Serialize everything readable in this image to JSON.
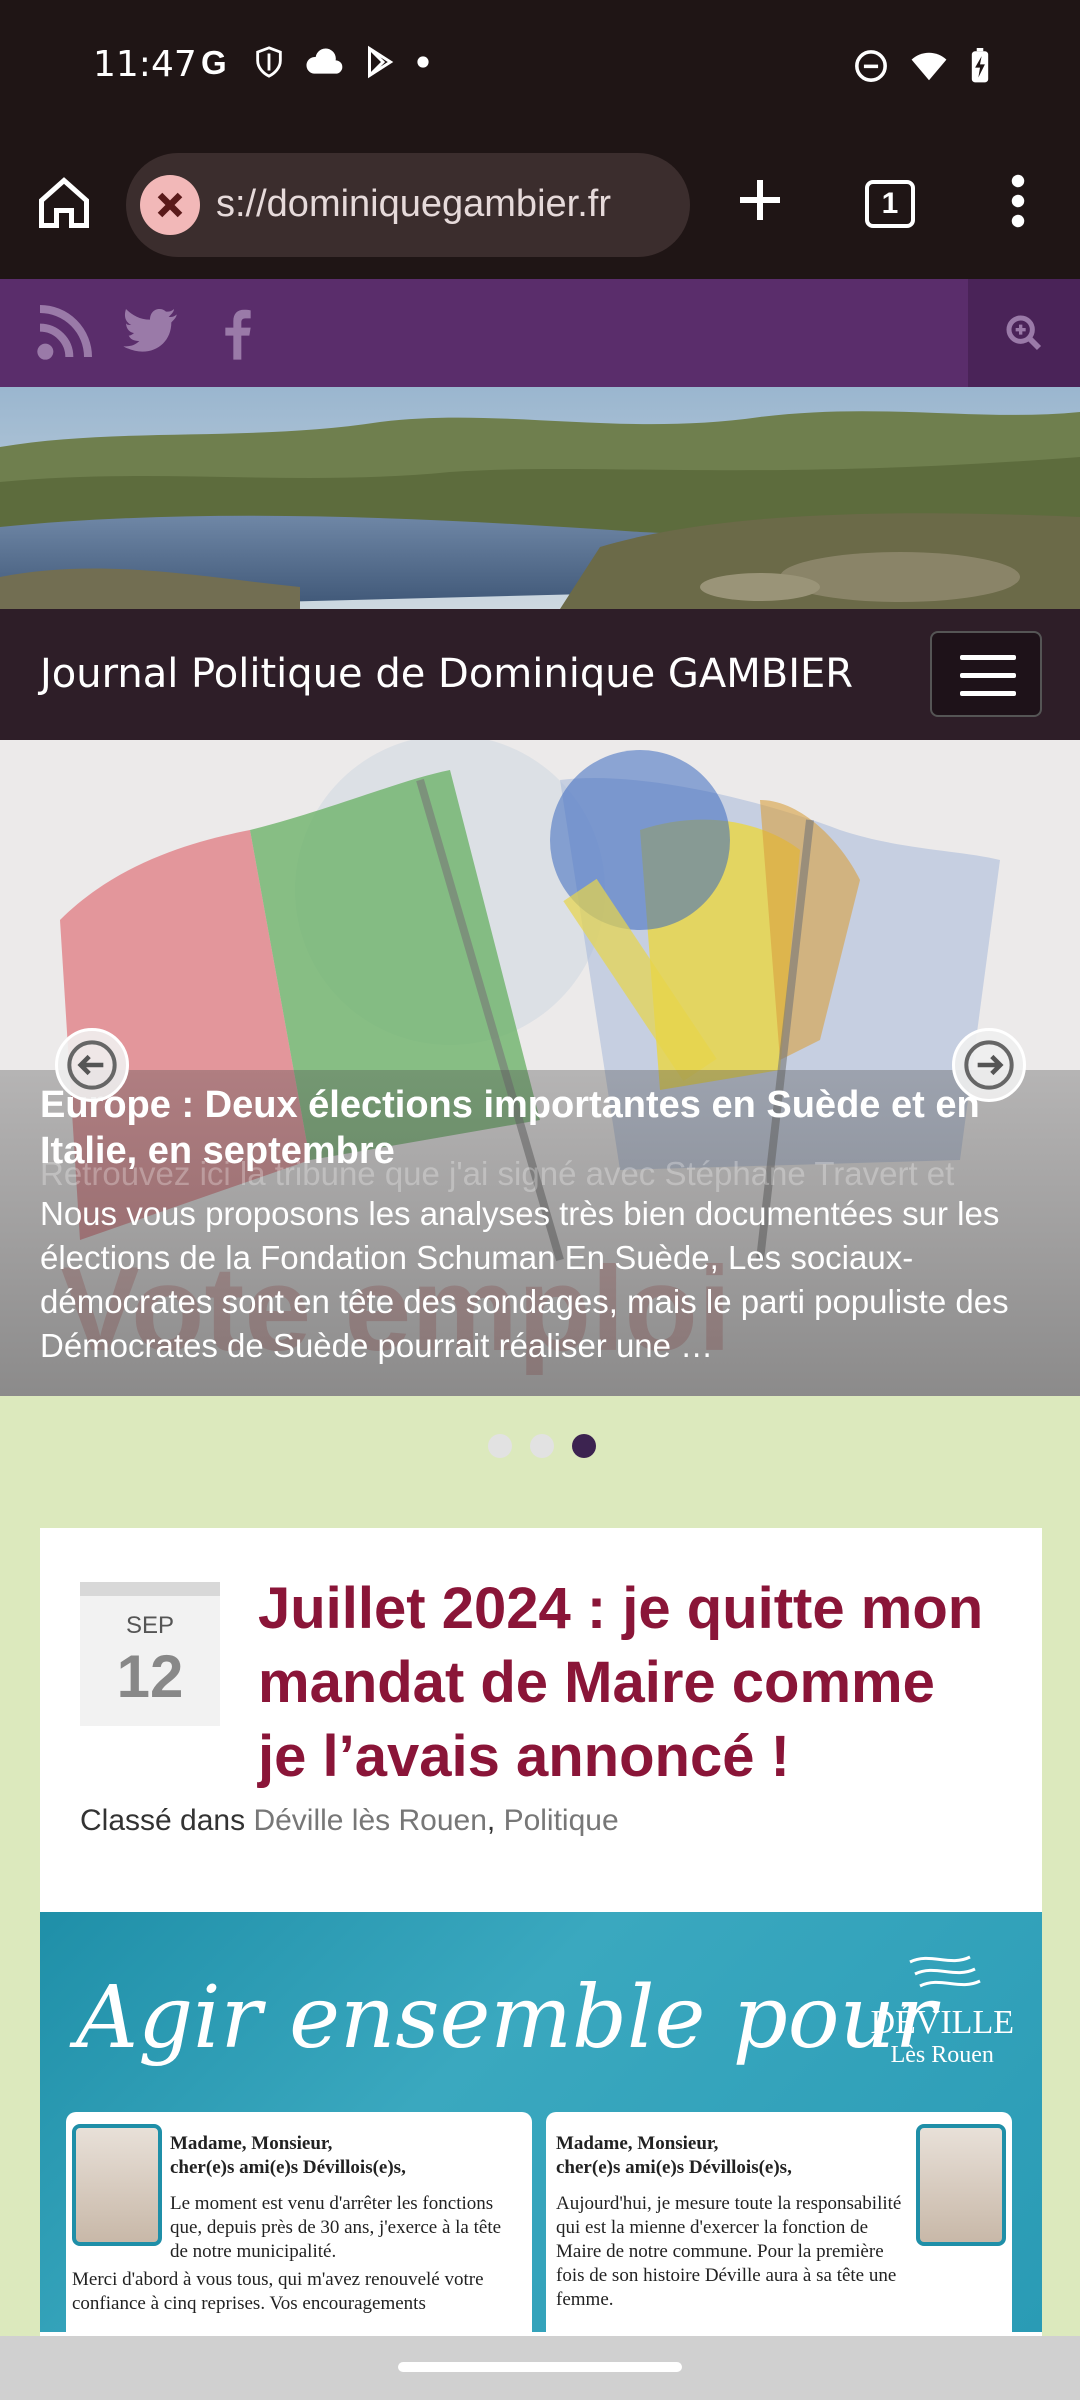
{
  "status": {
    "time": "11:47"
  },
  "browser": {
    "url": "s://dominiquegambier.fr",
    "tab_count": "1"
  },
  "site": {
    "title": "Journal Politique de Dominique GAMBIER"
  },
  "slider": {
    "title": "Europe : Deux élections importantes en Suède et en Italie, en septembre",
    "text": "Nous vous proposons les analyses très bien documentées sur les élections de la Fondation Schuman En Suède, Les sociaux-démocrates sont en tête des sondages, mais le parti populiste des Démocrates de Suède pourrait réaliser une …",
    "ghost_title": "Europe : Deux élections importantes",
    "ghost_text": "Retrouvez ici la tribune que j'ai signé avec Stéphane Travert et",
    "dots": 3,
    "active_dot": 3
  },
  "post": {
    "month": "SEP",
    "day": "12",
    "title": "Juillet 2024 : je quitte mon mandat de Maire comme je l’avais annoncé !",
    "category_label": "Classé dans",
    "categories": [
      "Déville lès Rouen",
      "Politique"
    ],
    "image": {
      "headline": "Agir ensemble pour",
      "brand": "DÉVILLE",
      "brand_sub": "Lès Rouen",
      "letter_left_salutation": "Madame, Monsieur,",
      "letter_left_salutation2": "cher(e)s ami(e)s Dévillois(e)s,",
      "letter_left_body": "Le moment est venu d'arrêter les fonctions que, depuis près de 30 ans, j'exerce à la tête de notre municipalité.",
      "letter_left_body2": "Merci d'abord à vous tous, qui m'avez renouvelé votre confiance à cinq reprises. Vos encouragements",
      "letter_right_salutation": "Madame, Monsieur,",
      "letter_right_salutation2": "cher(e)s ami(e)s Dévillois(e)s,",
      "letter_right_body": "Aujourd'hui, je mesure toute la responsabilité qui est la mienne d'exercer la fonction de Maire de notre commune. Pour la première fois de son histoire Déville aura à sa tête une femme."
    }
  }
}
